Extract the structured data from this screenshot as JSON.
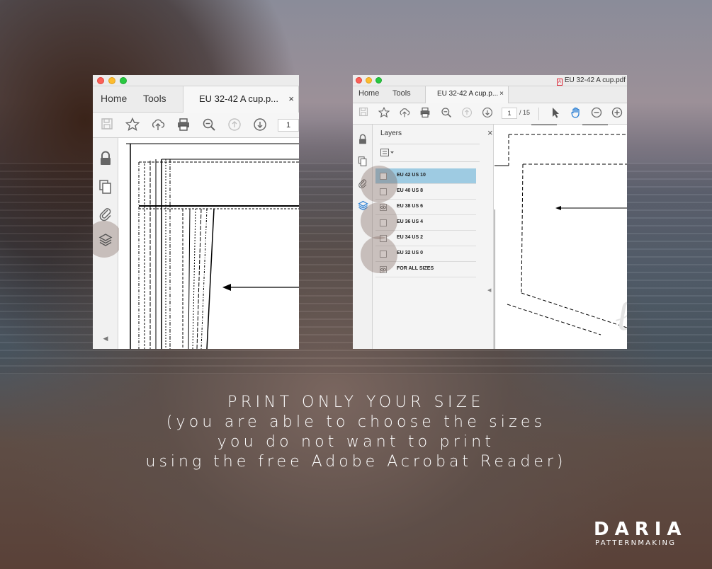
{
  "left_window": {
    "nav": {
      "home": "Home",
      "tools": "Tools"
    },
    "doc_tab": {
      "title": "EU 32-42 A cup.p...",
      "close": "×"
    },
    "toolbar": {
      "icons": [
        "save-icon",
        "bookmark-star-icon",
        "upload-cloud-icon",
        "print-icon",
        "zoom-out-icon",
        "page-up-icon",
        "page-down-icon"
      ],
      "page_number": "1"
    },
    "sidebar": {
      "icons": [
        "lock-icon",
        "copy-pages-icon",
        "attachment-clip-icon",
        "layers-icon"
      ]
    }
  },
  "right_window": {
    "titlebar": {
      "doc_title": "EU 32-42 A cup.pdf"
    },
    "nav": {
      "home": "Home",
      "tools": "Tools"
    },
    "doc_tab": {
      "title": "EU 32-42 A cup.p...",
      "close": "×"
    },
    "toolbar": {
      "icons": [
        "save-icon",
        "bookmark-star-icon",
        "upload-cloud-icon",
        "print-icon",
        "zoom-out-icon",
        "page-up-icon",
        "page-down-icon",
        "select-cursor-icon",
        "hand-tool-icon",
        "zoom-minus-icon",
        "zoom-plus-icon"
      ],
      "page_number": "1",
      "page_total": "/ 15"
    },
    "sidebar": {
      "icons": [
        "lock-icon",
        "copy-pages-icon",
        "attachment-clip-icon",
        "layers-icon"
      ]
    },
    "layers_panel": {
      "title": "Layers",
      "close": "×",
      "options_icon": "layer-options-icon",
      "rows": [
        {
          "label": "EU 42 US 10",
          "visible": false,
          "selected": true
        },
        {
          "label": "EU 40 US 8",
          "visible": false,
          "selected": false
        },
        {
          "label": "EU 38 US 6",
          "visible": true,
          "selected": false
        },
        {
          "label": "EU 36 US 4",
          "visible": false,
          "selected": false
        },
        {
          "label": "EU 34 US 2",
          "visible": false,
          "selected": false
        },
        {
          "label": "EU 32 US 0",
          "visible": false,
          "selected": false
        },
        {
          "label": "FOR ALL SIZES",
          "visible": true,
          "selected": false
        }
      ]
    }
  },
  "caption": {
    "line1": "PRINT ONLY YOUR SIZE",
    "line2": "(you are able to choose the sizes",
    "line3": "you do not want to print",
    "line4": "using the free Adobe Acrobat Reader)"
  },
  "logo": {
    "name": "DARIA",
    "tagline": "PATTERNMAKING"
  },
  "colors": {
    "selected_row": "#9ecbe2",
    "highlight_circle": "#8c7a72",
    "layers_accent": "#2a7fd4"
  }
}
